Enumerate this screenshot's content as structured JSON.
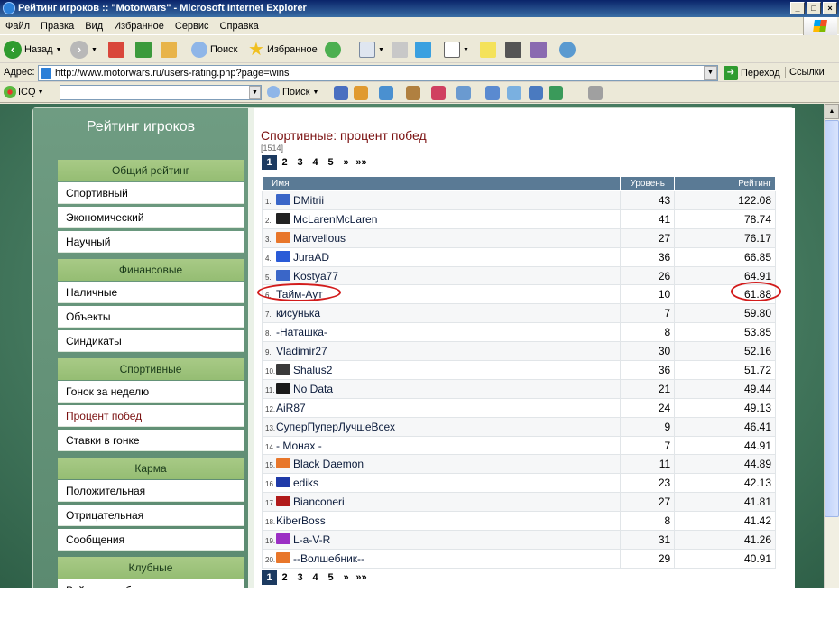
{
  "window": {
    "title": "Рейтинг игроков :: \"Motorwars\" - Microsoft Internet Explorer"
  },
  "menu": [
    "Файл",
    "Правка",
    "Вид",
    "Избранное",
    "Сервис",
    "Справка"
  ],
  "toolbar": {
    "back_label": "Назад",
    "search_label": "Поиск",
    "favorites_label": "Избранное"
  },
  "address": {
    "label": "Адрес:",
    "url": "http://www.motorwars.ru/users-rating.php?page=wins",
    "go_label": "Переход",
    "links_label": "Ссылки"
  },
  "icq": {
    "label": "ICQ",
    "search_label": "Поиск"
  },
  "sidebar": {
    "title": "Рейтинг игроков",
    "categories": [
      {
        "header": "Общий рейтинг",
        "items": [
          "Спортивный",
          "Экономический",
          "Научный"
        ]
      },
      {
        "header": "Финансовые",
        "items": [
          "Наличные",
          "Объекты",
          "Синдикаты"
        ]
      },
      {
        "header": "Спортивные",
        "items": [
          "Гонок за неделю",
          "Процент побед",
          "Ставки в гонке"
        ]
      },
      {
        "header": "Карма",
        "items": [
          "Положительная",
          "Отрицательная",
          "Сообщения"
        ]
      },
      {
        "header": "Клубные",
        "items": [
          "Рейтинг клубов"
        ]
      }
    ],
    "active_item": "Процент побед"
  },
  "content": {
    "title": "Спортивные: процент побед",
    "count": "[1514]",
    "pager": [
      "1",
      "2",
      "3",
      "4",
      "5",
      "»",
      "»»"
    ],
    "current_page": "1",
    "columns": {
      "name": "Имя",
      "level": "Уровень",
      "rating": "Рейтинг"
    },
    "rows": [
      {
        "n": "1.",
        "name": "DMitrii",
        "level": "43",
        "rating": "122.08",
        "avatar": "#3a66c8"
      },
      {
        "n": "2.",
        "name": "McLarenMcLaren",
        "level": "41",
        "rating": "78.74",
        "avatar": "#222222"
      },
      {
        "n": "3.",
        "name": "Marvellous",
        "level": "27",
        "rating": "76.17",
        "avatar": "#e8762a"
      },
      {
        "n": "4.",
        "name": "JuraAD",
        "level": "36",
        "rating": "66.85",
        "avatar": "#2a5bd7"
      },
      {
        "n": "5.",
        "name": "Kostya77",
        "level": "26",
        "rating": "64.91",
        "avatar": "#3a66c8"
      },
      {
        "n": "6.",
        "name": "Тайм-Аут",
        "level": "10",
        "rating": "61.88",
        "avatar": ""
      },
      {
        "n": "7.",
        "name": "кисунька",
        "level": "7",
        "rating": "59.80",
        "avatar": ""
      },
      {
        "n": "8.",
        "name": "-Наташка-",
        "level": "8",
        "rating": "53.85",
        "avatar": ""
      },
      {
        "n": "9.",
        "name": "Vladimir27",
        "level": "30",
        "rating": "52.16",
        "avatar": ""
      },
      {
        "n": "10.",
        "name": "Shalus2",
        "level": "36",
        "rating": "51.72",
        "avatar": "#3a3a3a"
      },
      {
        "n": "11.",
        "name": "No Data",
        "level": "21",
        "rating": "49.44",
        "avatar": "#1a1a1a"
      },
      {
        "n": "12.",
        "name": "AiR87",
        "level": "24",
        "rating": "49.13",
        "avatar": ""
      },
      {
        "n": "13.",
        "name": "СуперПуперЛучшеВсех",
        "level": "9",
        "rating": "46.41",
        "avatar": ""
      },
      {
        "n": "14.",
        "name": "- Монах -",
        "level": "7",
        "rating": "44.91",
        "avatar": ""
      },
      {
        "n": "15.",
        "name": "Black Daemon",
        "level": "11",
        "rating": "44.89",
        "avatar": "#e8762a"
      },
      {
        "n": "16.",
        "name": "ediks",
        "level": "23",
        "rating": "42.13",
        "avatar": "#1f3aa8"
      },
      {
        "n": "17.",
        "name": "Bianconeri",
        "level": "27",
        "rating": "41.81",
        "avatar": "#b11a1a"
      },
      {
        "n": "18.",
        "name": "KiberBoss",
        "level": "8",
        "rating": "41.42",
        "avatar": ""
      },
      {
        "n": "19.",
        "name": "L-a-V-R",
        "level": "31",
        "rating": "41.26",
        "avatar": "#9b2fc4"
      },
      {
        "n": "20.",
        "name": "--Волшебник--",
        "level": "29",
        "rating": "40.91",
        "avatar": "#e8762a"
      }
    ]
  },
  "colors": {
    "highlight": "#d21b1b",
    "header_bg": "#5a7a95",
    "title_color": "#7a1010"
  }
}
